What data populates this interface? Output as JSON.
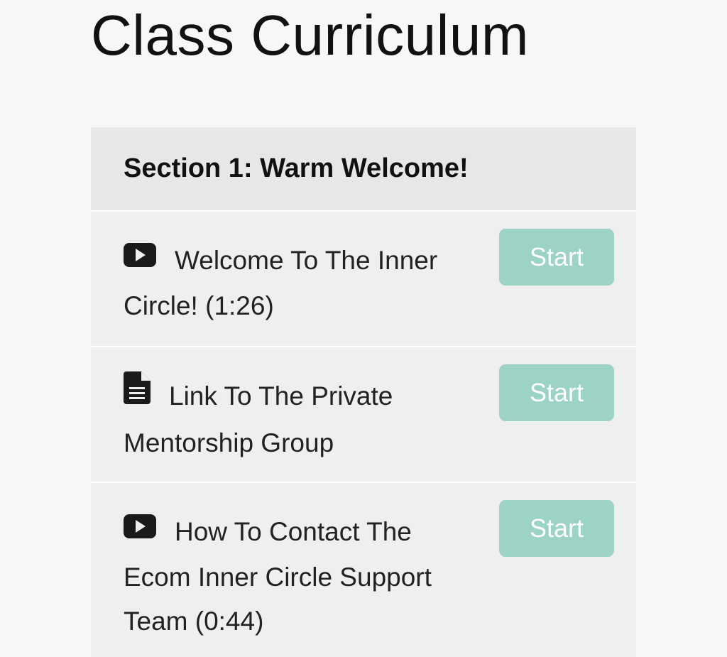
{
  "page": {
    "title": "Class Curriculum"
  },
  "section": {
    "title": "Section 1: Warm Welcome!",
    "lectures": [
      {
        "icon": "video-play-icon",
        "title": "Welcome To The Inner Circle! (1:26)",
        "button_label": "Start"
      },
      {
        "icon": "document-icon",
        "title": "Link To The Private Mentorship Group",
        "button_label": "Start"
      },
      {
        "icon": "video-play-icon",
        "title": "How To Contact The Ecom Inner Circle Support Team (0:44)",
        "button_label": "Start"
      }
    ]
  },
  "colors": {
    "background": "#f7f7f7",
    "section_header_bg": "#e7e7e7",
    "lecture_bg": "#efefef",
    "button_bg": "#9cd3c4",
    "button_text": "#ffffff"
  }
}
